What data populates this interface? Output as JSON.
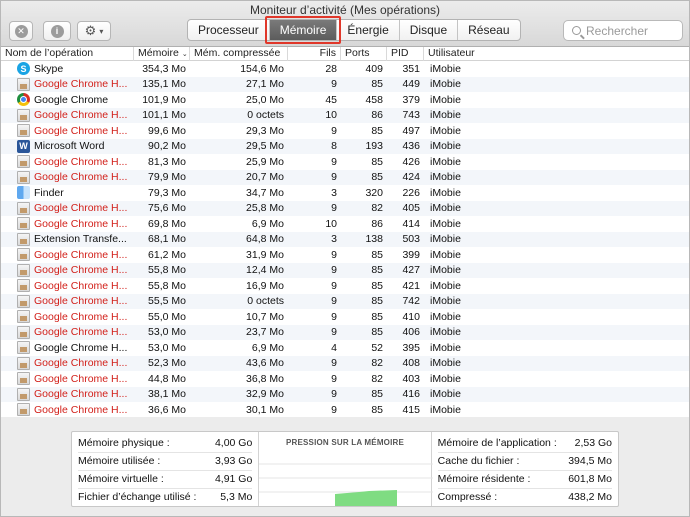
{
  "window": {
    "title": "Moniteur d’activité (Mes opérations)"
  },
  "toolbar": {
    "stop_glyph": "✕",
    "info_glyph": "i",
    "gear_glyph": "⚙",
    "chevron_glyph": "▾",
    "tabs": [
      {
        "label": "Processeur",
        "active": false
      },
      {
        "label": "Mémoire",
        "active": true
      },
      {
        "label": "Énergie",
        "active": false
      },
      {
        "label": "Disque",
        "active": false
      },
      {
        "label": "Réseau",
        "active": false
      }
    ],
    "search_placeholder": "Rechercher"
  },
  "colors": {
    "accent_highlight": "#e0372a",
    "red_process": "#d2201a",
    "pressure_green": "#7fdc82"
  },
  "table": {
    "columns": {
      "name": "Nom de l’opération",
      "memory": "Mémoire",
      "compressed": "Mém. compressée",
      "threads": "Fils",
      "ports": "Ports",
      "pid": "PID",
      "user": "Utilisateur"
    },
    "sort_glyph": "⌄",
    "rows": [
      {
        "name": "Skype",
        "icon": "skype-icon",
        "red": false,
        "mem": "354,3 Mo",
        "comp": "154,6 Mo",
        "fils": "28",
        "ports": "409",
        "pid": "351",
        "user": "iMobie"
      },
      {
        "name": "Google Chrome H...",
        "icon": "generic-app-icon",
        "red": true,
        "mem": "135,1 Mo",
        "comp": "27,1 Mo",
        "fils": "9",
        "ports": "85",
        "pid": "449",
        "user": "iMobie"
      },
      {
        "name": "Google Chrome",
        "icon": "chrome-icon",
        "red": false,
        "mem": "101,9 Mo",
        "comp": "25,0 Mo",
        "fils": "45",
        "ports": "458",
        "pid": "379",
        "user": "iMobie"
      },
      {
        "name": "Google Chrome H...",
        "icon": "generic-app-icon",
        "red": true,
        "mem": "101,1 Mo",
        "comp": "0 octets",
        "fils": "10",
        "ports": "86",
        "pid": "743",
        "user": "iMobie"
      },
      {
        "name": "Google Chrome H...",
        "icon": "generic-app-icon",
        "red": true,
        "mem": "99,6 Mo",
        "comp": "29,3 Mo",
        "fils": "9",
        "ports": "85",
        "pid": "497",
        "user": "iMobie"
      },
      {
        "name": "Microsoft Word",
        "icon": "word-icon",
        "red": false,
        "mem": "90,2 Mo",
        "comp": "29,5 Mo",
        "fils": "8",
        "ports": "193",
        "pid": "436",
        "user": "iMobie"
      },
      {
        "name": "Google Chrome H...",
        "icon": "generic-app-icon",
        "red": true,
        "mem": "81,3 Mo",
        "comp": "25,9 Mo",
        "fils": "9",
        "ports": "85",
        "pid": "426",
        "user": "iMobie"
      },
      {
        "name": "Google Chrome H...",
        "icon": "generic-app-icon",
        "red": true,
        "mem": "79,9 Mo",
        "comp": "20,7 Mo",
        "fils": "9",
        "ports": "85",
        "pid": "424",
        "user": "iMobie"
      },
      {
        "name": "Finder",
        "icon": "finder-icon",
        "red": false,
        "mem": "79,3 Mo",
        "comp": "34,7 Mo",
        "fils": "3",
        "ports": "320",
        "pid": "226",
        "user": "iMobie"
      },
      {
        "name": "Google Chrome H...",
        "icon": "generic-app-icon",
        "red": true,
        "mem": "75,6 Mo",
        "comp": "25,8 Mo",
        "fils": "9",
        "ports": "82",
        "pid": "405",
        "user": "iMobie"
      },
      {
        "name": "Google Chrome H...",
        "icon": "generic-app-icon",
        "red": true,
        "mem": "69,8 Mo",
        "comp": "6,9 Mo",
        "fils": "10",
        "ports": "86",
        "pid": "414",
        "user": "iMobie"
      },
      {
        "name": "Extension Transfe...",
        "icon": "generic-app-icon",
        "red": false,
        "mem": "68,1 Mo",
        "comp": "64,8 Mo",
        "fils": "3",
        "ports": "138",
        "pid": "503",
        "user": "iMobie"
      },
      {
        "name": "Google Chrome H...",
        "icon": "generic-app-icon",
        "red": true,
        "mem": "61,2 Mo",
        "comp": "31,9 Mo",
        "fils": "9",
        "ports": "85",
        "pid": "399",
        "user": "iMobie"
      },
      {
        "name": "Google Chrome H...",
        "icon": "generic-app-icon",
        "red": true,
        "mem": "55,8 Mo",
        "comp": "12,4 Mo",
        "fils": "9",
        "ports": "85",
        "pid": "427",
        "user": "iMobie"
      },
      {
        "name": "Google Chrome H...",
        "icon": "generic-app-icon",
        "red": true,
        "mem": "55,8 Mo",
        "comp": "16,9 Mo",
        "fils": "9",
        "ports": "85",
        "pid": "421",
        "user": "iMobie"
      },
      {
        "name": "Google Chrome H...",
        "icon": "generic-app-icon",
        "red": true,
        "mem": "55,5 Mo",
        "comp": "0 octets",
        "fils": "9",
        "ports": "85",
        "pid": "742",
        "user": "iMobie"
      },
      {
        "name": "Google Chrome H...",
        "icon": "generic-app-icon",
        "red": true,
        "mem": "55,0 Mo",
        "comp": "10,7 Mo",
        "fils": "9",
        "ports": "85",
        "pid": "410",
        "user": "iMobie"
      },
      {
        "name": "Google Chrome H...",
        "icon": "generic-app-icon",
        "red": true,
        "mem": "53,0 Mo",
        "comp": "23,7 Mo",
        "fils": "9",
        "ports": "85",
        "pid": "406",
        "user": "iMobie"
      },
      {
        "name": "Google Chrome H...",
        "icon": "generic-app-icon",
        "red": false,
        "mem": "53,0 Mo",
        "comp": "6,9 Mo",
        "fils": "4",
        "ports": "52",
        "pid": "395",
        "user": "iMobie"
      },
      {
        "name": "Google Chrome H...",
        "icon": "generic-app-icon",
        "red": true,
        "mem": "52,3 Mo",
        "comp": "43,6 Mo",
        "fils": "9",
        "ports": "82",
        "pid": "408",
        "user": "iMobie"
      },
      {
        "name": "Google Chrome H...",
        "icon": "generic-app-icon",
        "red": true,
        "mem": "44,8 Mo",
        "comp": "36,8 Mo",
        "fils": "9",
        "ports": "82",
        "pid": "403",
        "user": "iMobie"
      },
      {
        "name": "Google Chrome H...",
        "icon": "generic-app-icon",
        "red": true,
        "mem": "38,1 Mo",
        "comp": "32,9 Mo",
        "fils": "9",
        "ports": "85",
        "pid": "416",
        "user": "iMobie"
      },
      {
        "name": "Google Chrome H...",
        "icon": "generic-app-icon",
        "red": true,
        "mem": "36,6 Mo",
        "comp": "30,1 Mo",
        "fils": "9",
        "ports": "85",
        "pid": "415",
        "user": "iMobie"
      }
    ]
  },
  "summary": {
    "left": [
      {
        "label": "Mémoire physique :",
        "value": "4,00 Go"
      },
      {
        "label": "Mémoire utilisée :",
        "value": "3,93 Go"
      },
      {
        "label": "Mémoire virtuelle :",
        "value": "4,91 Go"
      },
      {
        "label": "Fichier d’échange utilisé :",
        "value": "5,3 Mo"
      }
    ],
    "pressure_title": "PRESSION SUR LA MÉMOIRE",
    "right": [
      {
        "label": "Mémoire de l’application :",
        "value": "2,53 Go"
      },
      {
        "label": "Cache du fichier :",
        "value": "394,5 Mo"
      },
      {
        "label": "Mémoire résidente :",
        "value": "601,8 Mo"
      },
      {
        "label": "Compressé :",
        "value": "438,2 Mo"
      }
    ]
  }
}
